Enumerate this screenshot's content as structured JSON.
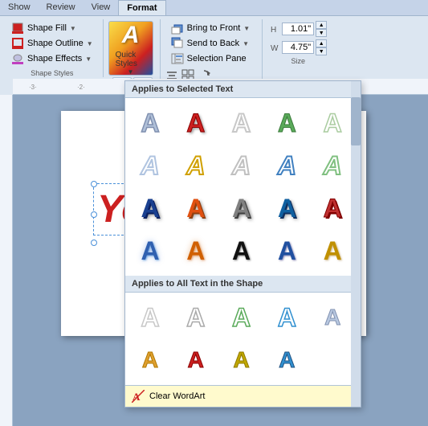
{
  "tabs": [
    {
      "label": "Show",
      "active": false
    },
    {
      "label": "Review",
      "active": false
    },
    {
      "label": "View",
      "active": false
    },
    {
      "label": "Format",
      "active": true
    }
  ],
  "ribbon": {
    "shape_fill": "Shape Fill",
    "shape_outline": "Shape Outline",
    "shape_effects": "Shape Effects",
    "quick_styles": "Quick Styles",
    "bring_to_front": "Bring to Front",
    "send_to_back": "Send to Back",
    "selection_pane": "Selection Pane",
    "size_h": "1.01\"",
    "size_w": "4.75\""
  },
  "dropdown": {
    "section1_title": "Applies to Selected Text",
    "section2_title": "Applies to All Text in the Shape",
    "clear_label": "Clear WordArt"
  },
  "slide": {
    "text": "Your"
  }
}
